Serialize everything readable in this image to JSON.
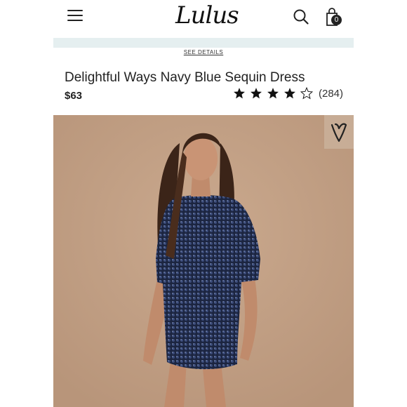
{
  "header": {
    "logo": "Lulus",
    "bag_count": "0",
    "icons": [
      "menu-icon",
      "search-icon",
      "shopping-bag-icon"
    ]
  },
  "promo": {
    "see_details": "SEE DETAILS"
  },
  "product": {
    "title": "Delightful Ways Navy Blue Sequin Dress",
    "price": "$63",
    "rating": 4,
    "rating_max": 5,
    "review_count": "(284)"
  },
  "colors": {
    "background_beige": "#c19f83",
    "dress_navy": "#1c2540",
    "promo_bar": "#e5eff0"
  }
}
